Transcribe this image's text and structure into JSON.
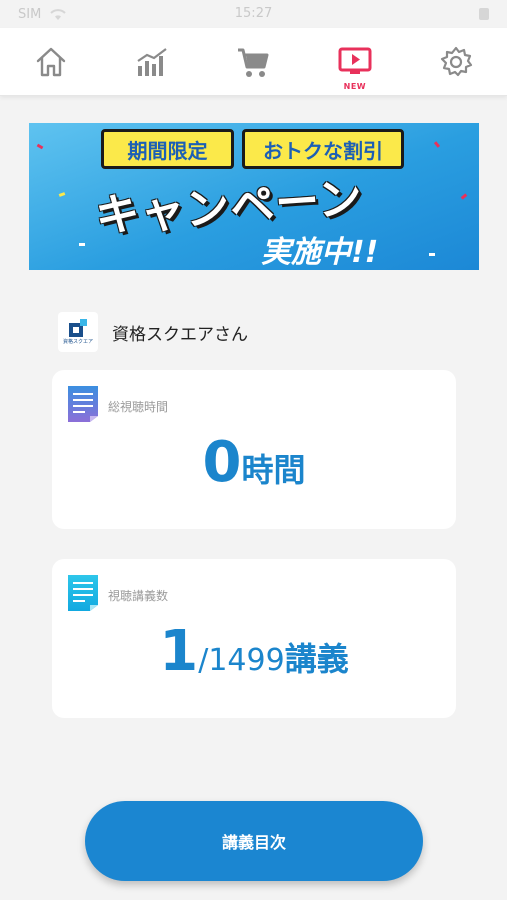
{
  "status_bar": {
    "carrier": "SIM",
    "time": "15:27"
  },
  "nav": {
    "items": [
      {
        "icon": "home-icon"
      },
      {
        "icon": "chart-icon"
      },
      {
        "icon": "cart-icon"
      },
      {
        "icon": "video-icon",
        "badge": "NEW",
        "active": true
      },
      {
        "icon": "gear-icon"
      }
    ],
    "active_color": "#e8315b",
    "inactive_color": "#8a8a8a"
  },
  "banner": {
    "tag1": "期間限定",
    "tag2": "おトクな割引",
    "title": "キャンペーン",
    "subtitle": "実施中!!"
  },
  "user": {
    "logo_caption": "資格スクエア",
    "name": "資格スクエアさん"
  },
  "stats": {
    "watch_time": {
      "label": "総視聴時間",
      "value": "0",
      "unit": "時間"
    },
    "lectures": {
      "label": "視聴講義数",
      "value": "1",
      "total": "/1499",
      "unit": "講義"
    }
  },
  "toc_button": {
    "label": "講義目次"
  },
  "colors": {
    "accent": "#1b86d1",
    "value_text": "#1b85cc",
    "banner_tag": "#fbe94a"
  }
}
